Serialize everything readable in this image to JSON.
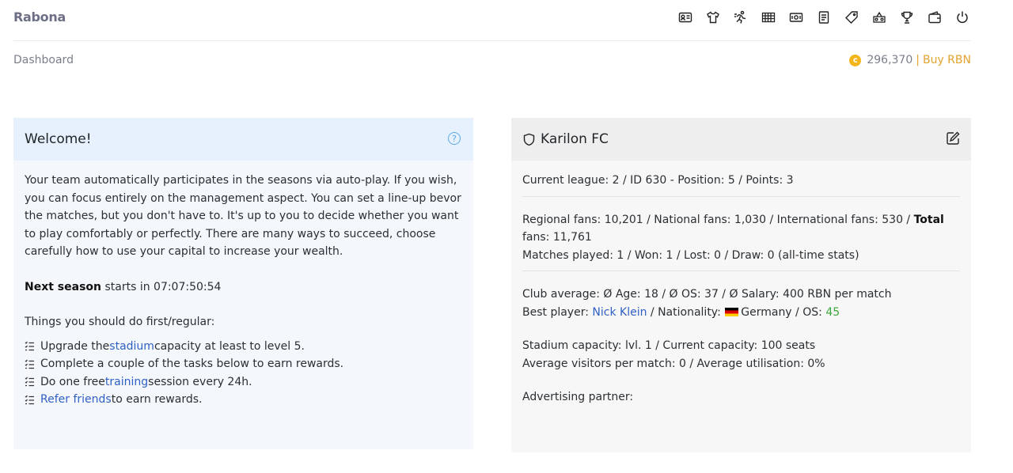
{
  "brand": "Rabona",
  "nav_icons": [
    "id-card-icon",
    "shirt-icon",
    "player-icon",
    "stadium-icon",
    "money-icon",
    "document-icon",
    "tag-icon",
    "fans-icon",
    "trophy-icon",
    "wallet-icon",
    "power-icon"
  ],
  "breadcrumb": "Dashboard",
  "balance": {
    "amount": "296,370",
    "separator": "|",
    "buy_label": "Buy RBN"
  },
  "welcome": {
    "title": "Welcome!",
    "intro": "Your team automatically participates in the seasons via auto-play. If you wish, you can focus entirely on the management aspect. You can set a line-up bevor the matches, but you don't have to. It's up to you to decide whether you want to play comfortably or perfectly. There are many ways to succeed, choose carefully how to use your capital to increase your wealth.",
    "next_season_label": "Next season",
    "next_season_text": " starts in 07:07:50:54",
    "things_label": "Things you should do first/regular:",
    "todo": [
      {
        "pre": "Upgrade the ",
        "link": "stadium",
        "post": " capacity at least to level 5."
      },
      {
        "pre": "Complete a couple of the tasks below to earn rewards.",
        "link": "",
        "post": ""
      },
      {
        "pre": "Do one free ",
        "link": "training",
        "post": " session every 24h."
      },
      {
        "pre": "",
        "link": "Refer friends",
        "post": " to earn rewards."
      }
    ]
  },
  "club": {
    "title": "Karilon FC",
    "league_line": "Current league: 2 / ID 630 - Position: 5 / Points: 3",
    "fans_prefix": "Regional fans: 10,201 / National fans: 1,030 / International fans: 530 / ",
    "fans_total_label": "Total",
    "fans_total_value": " fans: 11,761",
    "matches_line": "Matches played: 1 / Won: 1 / Lost: 0 / Draw: 0 (all-time stats)",
    "club_average": "Club average: Ø Age: 18 / Ø OS: 37 / Ø Salary: 400 RBN per match",
    "best_player_label": "Best player: ",
    "best_player_name": "Nick Klein",
    "nationality_label": " / Nationality: ",
    "nationality": "Germany",
    "os_label": " / OS: ",
    "os_value": "45",
    "stadium_line": "Stadium capacity: lvl. 1 / Current capacity: 100 seats",
    "visitors_line": "Average visitors per match: 0 / Average utilisation: 0%",
    "advertising_line": "Advertising partner:"
  },
  "colors": {
    "accent_gold": "#e3a32e",
    "link_blue": "#2f5fc4",
    "os_green": "#3aa83a"
  }
}
